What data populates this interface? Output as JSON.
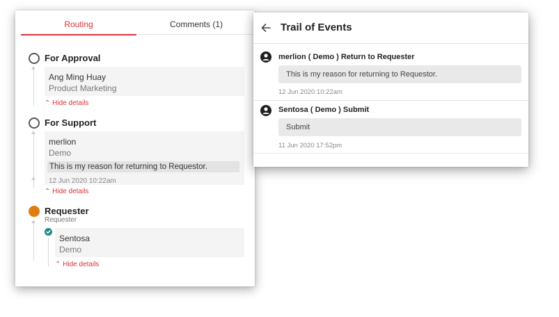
{
  "routing_panel": {
    "tabs": [
      {
        "label": "Routing",
        "active": true
      },
      {
        "label": "Comments (1)",
        "active": false
      }
    ],
    "steps": [
      {
        "title": "For Approval",
        "status": "pending",
        "card": {
          "name": "Ang Ming Huay",
          "dept": "Product Marketing"
        },
        "hide_label": "Hide details"
      },
      {
        "title": "For Support",
        "status": "pending",
        "card": {
          "name": "merlion",
          "dept": "Demo",
          "note": "This is my reason for returning to Requestor.",
          "time": "12 Jun 2020 10:22am"
        },
        "hide_label": "Hide details"
      },
      {
        "title": "Requester",
        "subtitle": "Requester",
        "status": "current",
        "card": {
          "name": "Sentosa",
          "dept": "Demo"
        },
        "hide_label": "Hide details"
      }
    ]
  },
  "trail_panel": {
    "title": "Trail of Events",
    "back_icon": "arrow-left-icon",
    "events": [
      {
        "title": "merlion ( Demo ) Return to Requester",
        "message": "This is my reason for returning to Requestor.",
        "time": "12 Jun 2020 10:22am"
      },
      {
        "title": "Sentosa ( Demo ) Submit",
        "message": "Submit",
        "time": "11 Jun 2020 17:52pm"
      }
    ]
  },
  "colors": {
    "accent_red": "#d9323a",
    "current_step_orange": "#e07c10",
    "check_teal": "#1a8a7e"
  }
}
